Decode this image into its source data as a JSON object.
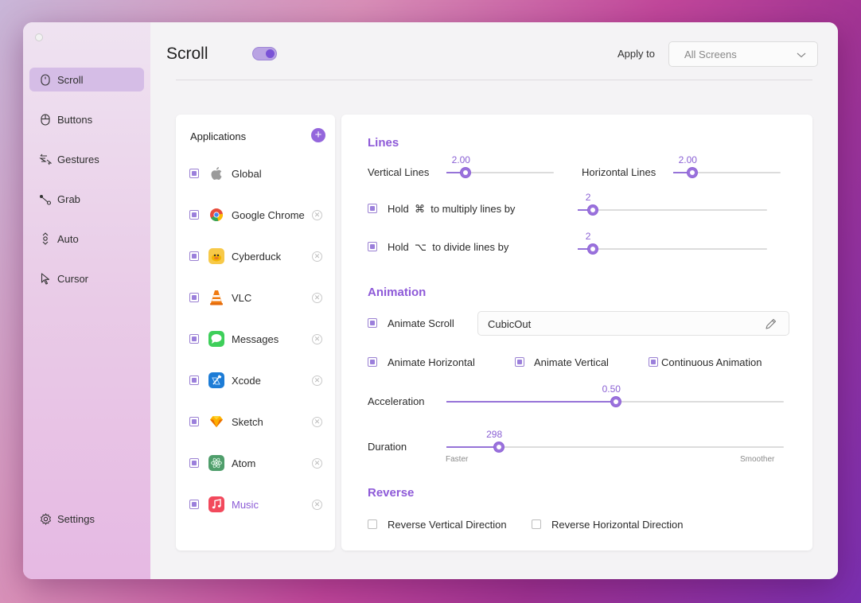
{
  "sidebar": {
    "items": [
      {
        "label": "Scroll",
        "icon": "mouse-scroll-icon",
        "active": true
      },
      {
        "label": "Buttons",
        "icon": "mouse-buttons-icon"
      },
      {
        "label": "Gestures",
        "icon": "gesture-icon"
      },
      {
        "label": "Grab",
        "icon": "grab-icon"
      },
      {
        "label": "Auto",
        "icon": "auto-scroll-icon"
      },
      {
        "label": "Cursor",
        "icon": "cursor-icon"
      }
    ],
    "settings_label": "Settings"
  },
  "header": {
    "title": "Scroll",
    "toggle_on": true,
    "apply_label": "Apply to",
    "apply_value": "All Screens"
  },
  "applications": {
    "title": "Applications",
    "items": [
      {
        "name": "Global",
        "icon": "apple-icon",
        "checked": true,
        "removable": false
      },
      {
        "name": "Google Chrome",
        "icon": "chrome-icon",
        "checked": true,
        "removable": true
      },
      {
        "name": "Cyberduck",
        "icon": "cyberduck-icon",
        "checked": true,
        "removable": true
      },
      {
        "name": "VLC",
        "icon": "vlc-icon",
        "checked": true,
        "removable": true
      },
      {
        "name": "Messages",
        "icon": "messages-icon",
        "checked": true,
        "removable": true
      },
      {
        "name": "Xcode",
        "icon": "xcode-icon",
        "checked": true,
        "removable": true
      },
      {
        "name": "Sketch",
        "icon": "sketch-icon",
        "checked": true,
        "removable": true
      },
      {
        "name": "Atom",
        "icon": "atom-icon",
        "checked": true,
        "removable": true
      },
      {
        "name": "Music",
        "icon": "music-icon",
        "checked": true,
        "removable": true,
        "selected": true
      }
    ]
  },
  "lines": {
    "title": "Lines",
    "vertical_label": "Vertical Lines",
    "vertical_value": "2.00",
    "vertical_fraction": 0.18,
    "horizontal_label": "Horizontal Lines",
    "horizontal_value": "2.00",
    "horizontal_fraction": 0.18,
    "multiply_pre": "Hold",
    "multiply_key": "⌘",
    "multiply_post": "to multiply lines by",
    "multiply_value": "2",
    "multiply_fraction": 0.08,
    "divide_pre": "Hold",
    "divide_key": "⌥",
    "divide_post": "to divide lines by",
    "divide_value": "2",
    "divide_fraction": 0.08
  },
  "animation": {
    "title": "Animation",
    "animate_scroll_label": "Animate Scroll",
    "curve_value": "CubicOut",
    "animate_horizontal_label": "Animate Horizontal",
    "animate_vertical_label": "Animate Vertical",
    "continuous_label": "Continuous Animation",
    "acceleration_label": "Acceleration",
    "acceleration_value": "0.50",
    "acceleration_fraction": 0.503,
    "duration_label": "Duration",
    "duration_value": "298",
    "duration_fraction": 0.156,
    "faster_label": "Faster",
    "smoother_label": "Smoother"
  },
  "reverse": {
    "title": "Reverse",
    "vertical_label": "Reverse Vertical Direction",
    "horizontal_label": "Reverse Horizontal Direction"
  },
  "colors": {
    "accent": "#9466dc",
    "sidebar_active": "#d5bde6"
  }
}
